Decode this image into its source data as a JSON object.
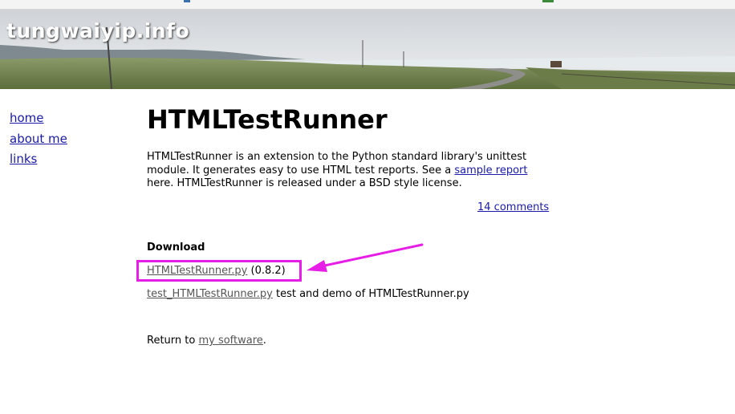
{
  "site": {
    "title": "tungwaiyip.info"
  },
  "nav": [
    {
      "label": "home"
    },
    {
      "label": "about me"
    },
    {
      "label": "links"
    }
  ],
  "page": {
    "title": "HTMLTestRunner",
    "intro_before_link": "HTMLTestRunner is an extension to the Python standard library's unittest module. It generates easy to use HTML test reports. See a ",
    "intro_link": "sample report",
    "intro_after_link": " here. HTMLTestRunner is released under a BSD style license.",
    "comments_link": "14 comments",
    "download_heading": "Download",
    "downloads": [
      {
        "file": "HTMLTestRunner.py",
        "note": " (0.8.2)"
      },
      {
        "file": "test_HTMLTestRunner.py",
        "note": " test and demo of HTMLTestRunner.py"
      }
    ],
    "return_prefix": "Return to ",
    "return_link": "my software",
    "return_suffix": "."
  },
  "annotation": {
    "highlight_color": "#e61ee6"
  }
}
